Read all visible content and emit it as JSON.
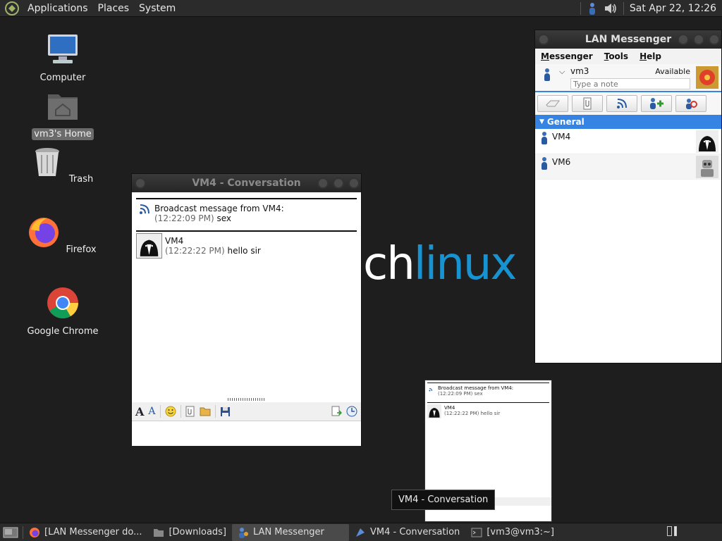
{
  "top_panel": {
    "menus": [
      "Applications",
      "Places",
      "System"
    ],
    "clock": "Sat Apr 22, 12:26"
  },
  "desktop": {
    "icons": [
      {
        "label": "Computer"
      },
      {
        "label": "vm3's Home"
      },
      {
        "label": "Trash"
      },
      {
        "label": "Firefox"
      },
      {
        "label": "Google Chrome"
      }
    ],
    "wallpaper_text": {
      "ch": "ch",
      "linux": "linux"
    }
  },
  "messenger": {
    "title": "LAN Messenger",
    "menus": [
      {
        "first": "M",
        "rest": "essenger"
      },
      {
        "first": "T",
        "rest": "ools"
      },
      {
        "first": "H",
        "rest": "elp"
      }
    ],
    "user": "vm3",
    "status": "Available",
    "note_placeholder": "Type a note",
    "group": "General",
    "contacts": [
      {
        "name": "VM4"
      },
      {
        "name": "VM6"
      }
    ]
  },
  "conversation": {
    "title": "VM4 - Conversation",
    "broadcast_header": "Broadcast message from VM4:",
    "broadcast_time": "(12:22:09 PM)",
    "broadcast_text": "sex",
    "msg_sender": "VM4",
    "msg_time": "(12:22:22 PM)",
    "msg_text": "hello sir"
  },
  "preview": {
    "broadcast_header": "Broadcast message from VM4:",
    "broadcast_line": "(12:22:09 PM) sex",
    "msg_sender": "VM4",
    "msg_line": "(12:22:22 PM) hello sir"
  },
  "tooltip": "VM4 - Conversation",
  "taskbar": {
    "items": [
      {
        "label": "[LAN Messenger do..."
      },
      {
        "label": "[Downloads]"
      },
      {
        "label": "LAN Messenger"
      },
      {
        "label": "VM4 - Conversation"
      },
      {
        "label": "[vm3@vm3:~]"
      }
    ]
  },
  "colors": {
    "accent": "#3584e4",
    "arch_blue": "#1793d1",
    "panel": "#2b2b2b",
    "desktop": "#1e1e1e"
  }
}
